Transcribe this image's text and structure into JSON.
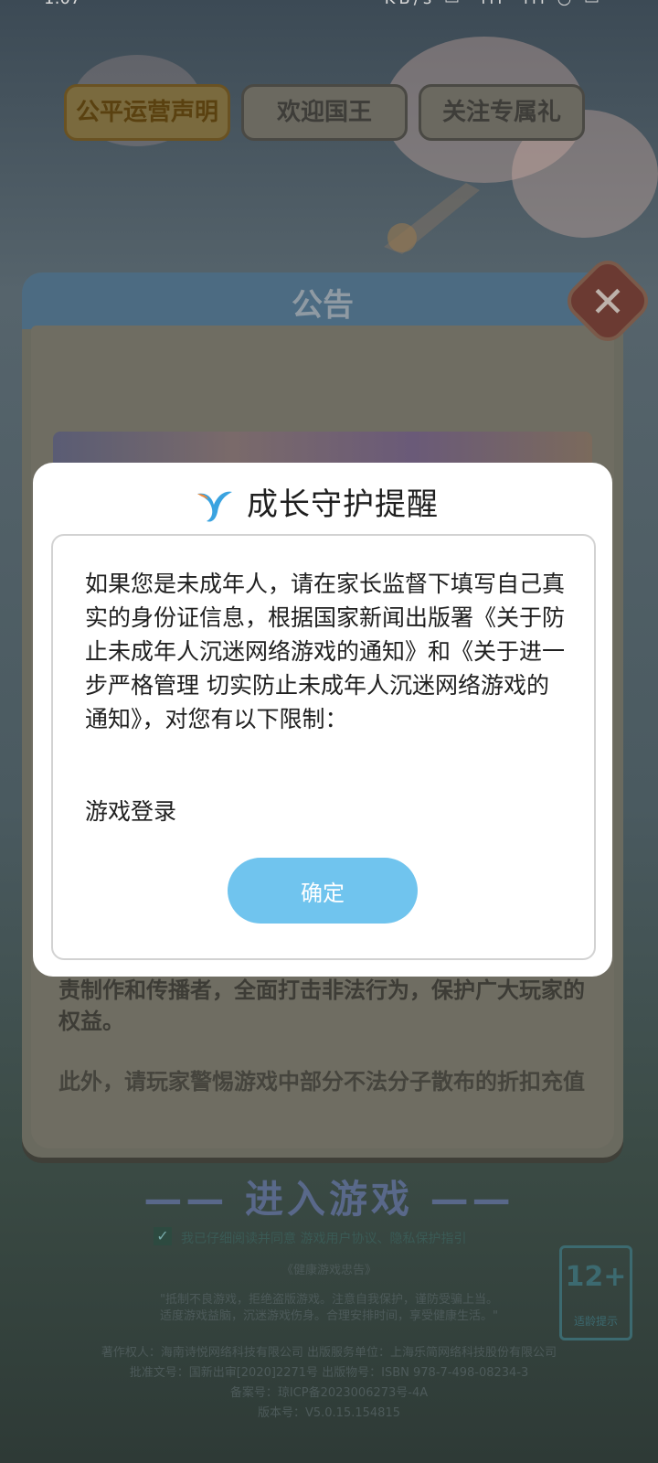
{
  "status_bar": {
    "time": "1:07",
    "icons": "KB/s ▭  ·ıll ·ıll ◔ ▭"
  },
  "background": {
    "enter_game": "——  进入游戏  ——",
    "agreement": "我已仔细阅读并同意 游戏用户协议、隐私保护指引",
    "health_title": "《健康游戏忠告》",
    "health_line1": "\"抵制不良游戏，拒绝盗版游戏。注意自我保护，谨防受骗上当。",
    "health_line2": "适度游戏益脑，沉迷游戏伤身。合理安排时间，享受健康生活。\"",
    "copyright": "著作权人：海南诗悦网络科技有限公司 出版服务单位：上海乐简网络科技股份有限公司",
    "approval": "批准文号：国新出审[2020]2271号 出版物号：ISBN 978-7-498-08234-3",
    "icp": "备案号：琼ICP备2023006273号-4A",
    "version": "版本号：V5.0.15.154815",
    "age_rating": "12+",
    "age_label": "适龄提示"
  },
  "notice": {
    "title": "公告",
    "tabs": [
      "公平运营声明",
      "欢迎国王",
      "关注专属礼"
    ],
    "body_p1": "责制作和传播者，全面打击非法行为，保护广大玩家的权益。",
    "body_p2": "此外，请玩家警惕游戏中部分不法分子散布的折扣充值等非官方渠道的充值返利活动，代办退款等非"
  },
  "dialog": {
    "title": "成长守护提醒",
    "message": "如果您是未成年人，请在家长监督下填写自己真实的身份证信息，根据国家新闻出版署《关于防止未成年人沉迷网络游戏的通知》和《关于进一步严格管理 切实防止未成年人沉迷网络游戏的通知》，对您有以下限制：",
    "limit": "游戏登录",
    "confirm": "确定"
  },
  "colors": {
    "confirm_button": "#70c4ee",
    "dialog_bg": "#ffffff"
  }
}
